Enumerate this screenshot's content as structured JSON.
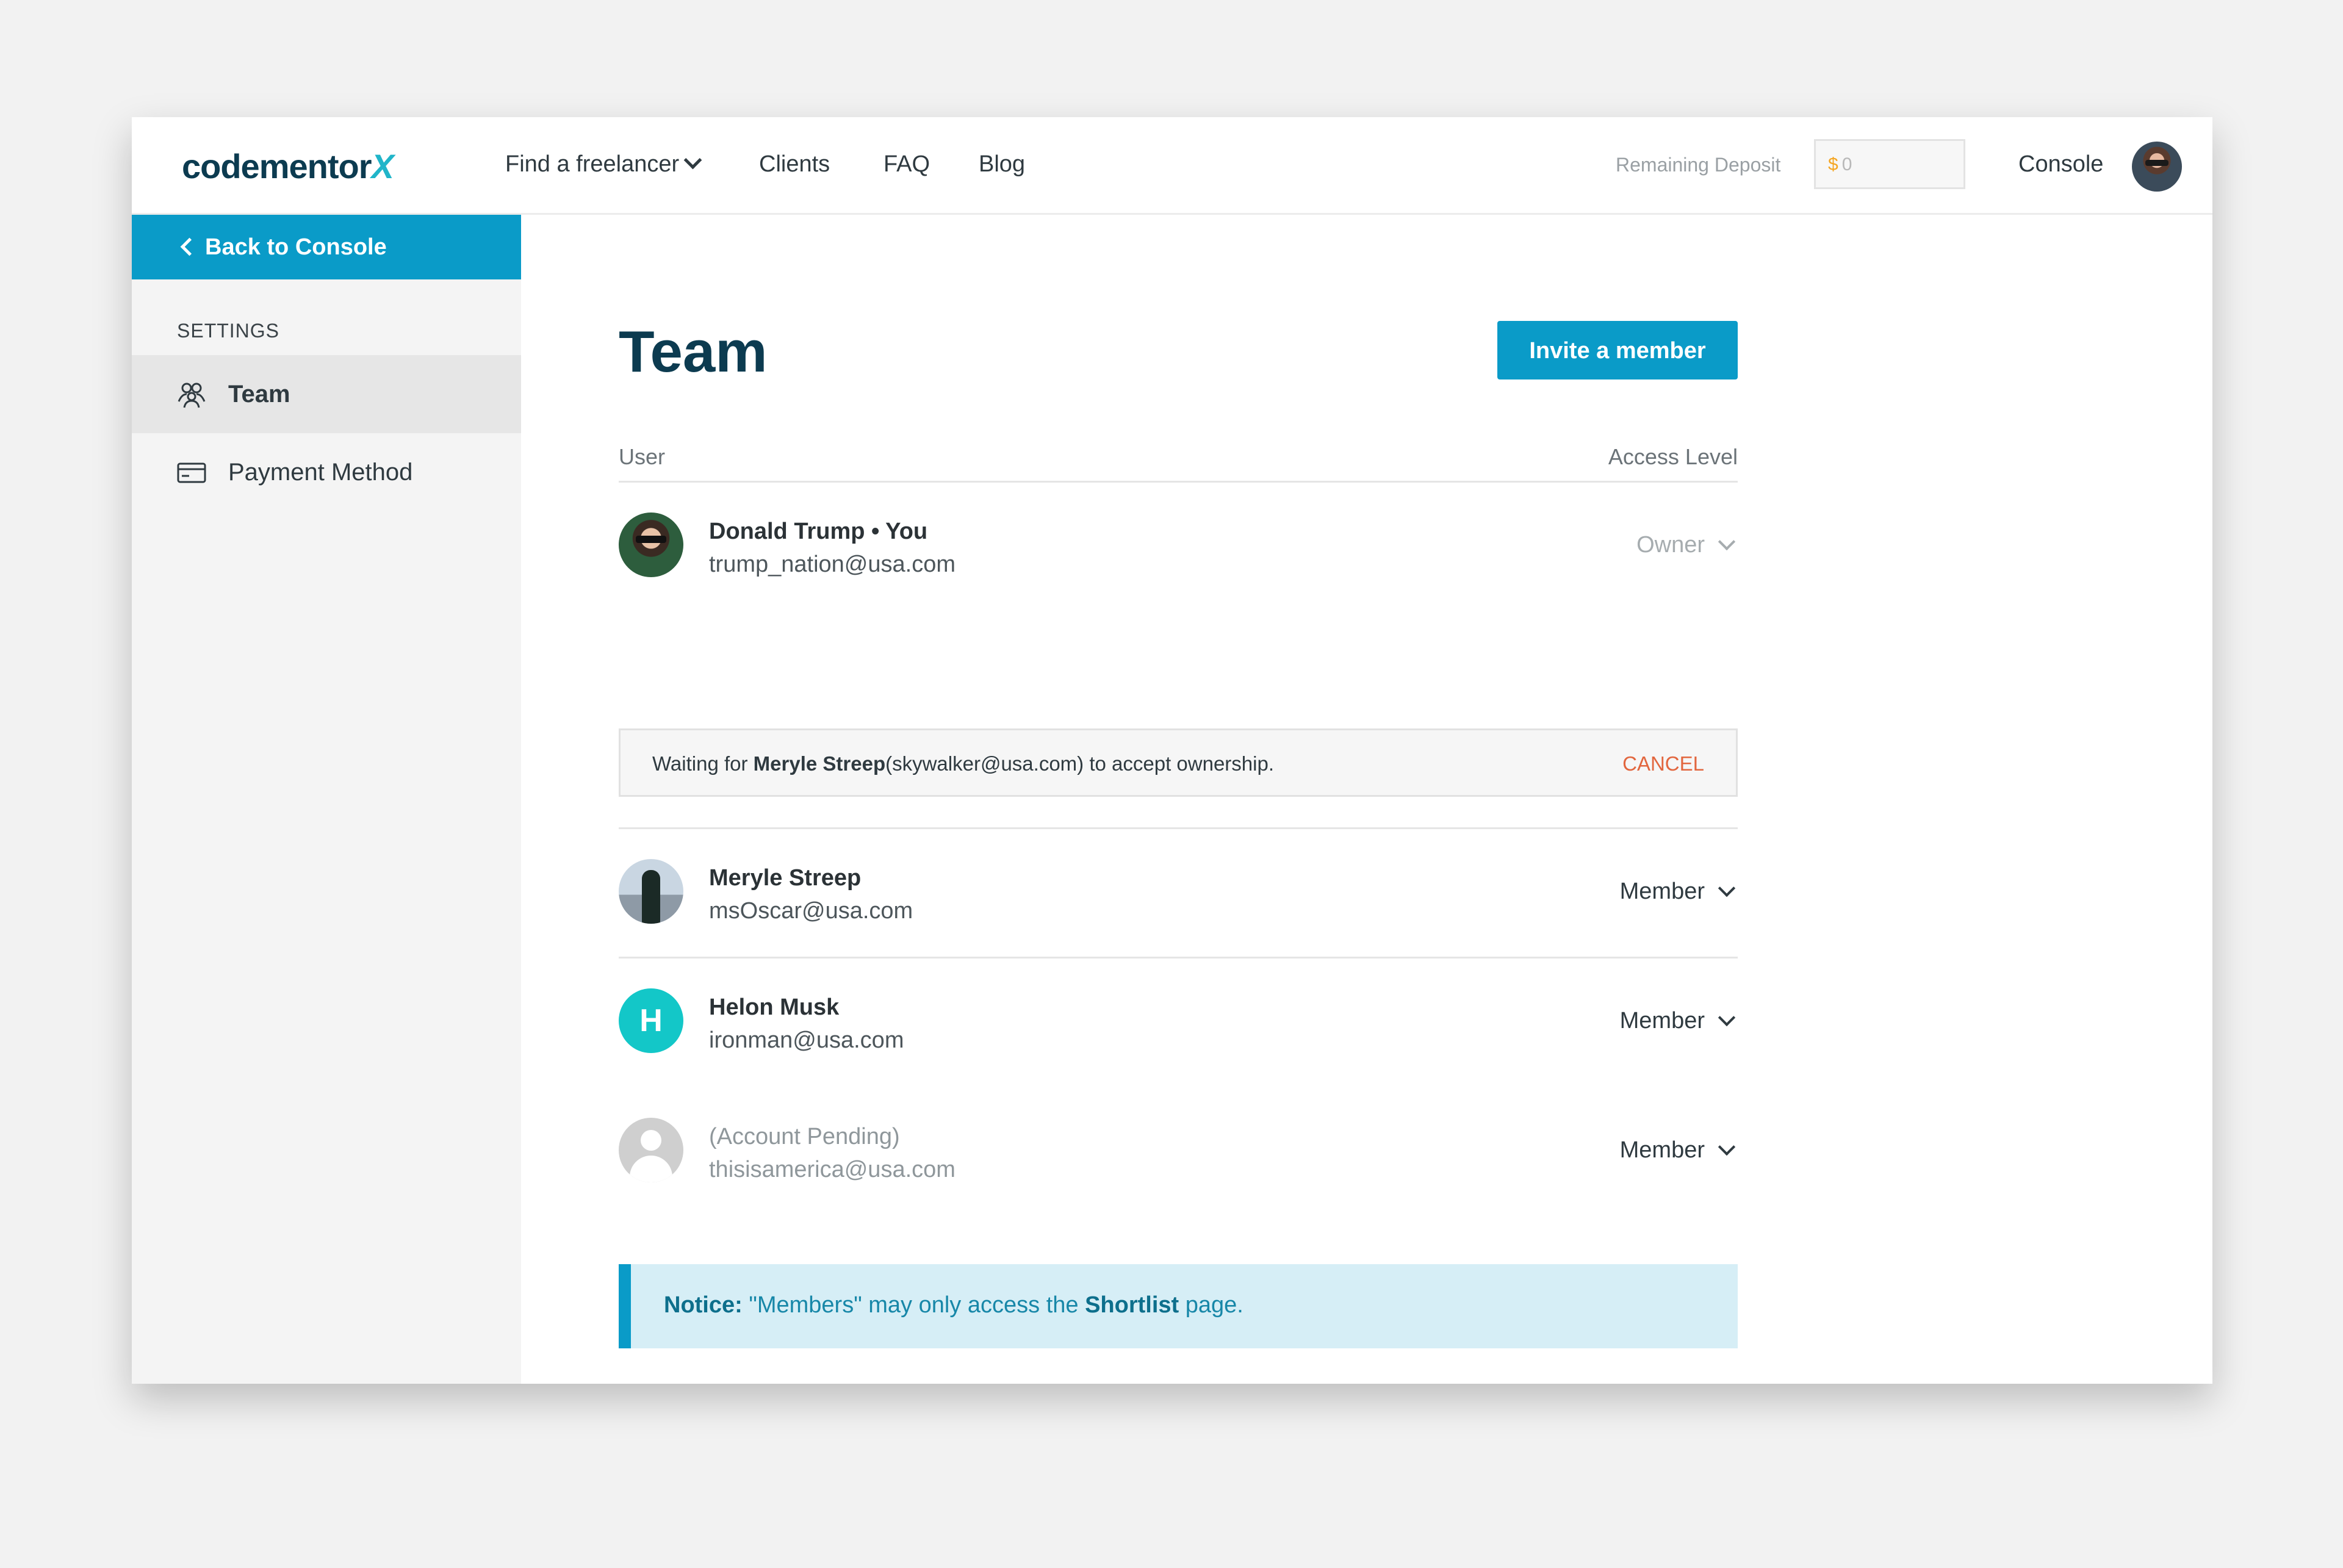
{
  "header": {
    "logo_main": "codementor",
    "logo_accent": "X",
    "nav": {
      "find": "Find a freelancer",
      "clients": "Clients",
      "faq": "FAQ",
      "blog": "Blog"
    },
    "deposit_label": "Remaining Deposit",
    "deposit_currency": "$",
    "deposit_value": "0",
    "console": "Console"
  },
  "sidebar": {
    "back": "Back to Console",
    "section": "SETTINGS",
    "items": [
      {
        "label": "Team",
        "icon": "team-icon",
        "active": true
      },
      {
        "label": "Payment Method",
        "icon": "credit-card-icon",
        "active": false
      }
    ]
  },
  "main": {
    "title": "Team",
    "invite_label": "Invite a member",
    "columns": {
      "user": "User",
      "access": "Access Level"
    },
    "members": [
      {
        "name": "Donald Trump • You",
        "email": "trump_nation@usa.com",
        "access": "Owner"
      },
      {
        "name": "Meryle Streep",
        "email": "msOscar@usa.com",
        "access": "Member"
      },
      {
        "name": "Helon Musk",
        "email": "ironman@usa.com",
        "access": "Member",
        "initial": "H"
      },
      {
        "name": "(Account Pending)",
        "email": "thisisamerica@usa.com",
        "access": "Member"
      }
    ],
    "pending": {
      "prefix": "Waiting for ",
      "name": "Meryle Streep",
      "suffix": "(skywalker@usa.com) to accept ownership.",
      "cancel": "CANCEL"
    },
    "notice": {
      "label": "Notice:",
      "text_before": " \"Members\" may only access the ",
      "link": "Shortlist",
      "text_after": " page."
    }
  },
  "colors": {
    "primary": "#0a9bc8",
    "brand_dark": "#0c3b50",
    "accent_teal": "#20b5c9",
    "cancel": "#e2663e",
    "notice_bg": "#d6eef6"
  }
}
